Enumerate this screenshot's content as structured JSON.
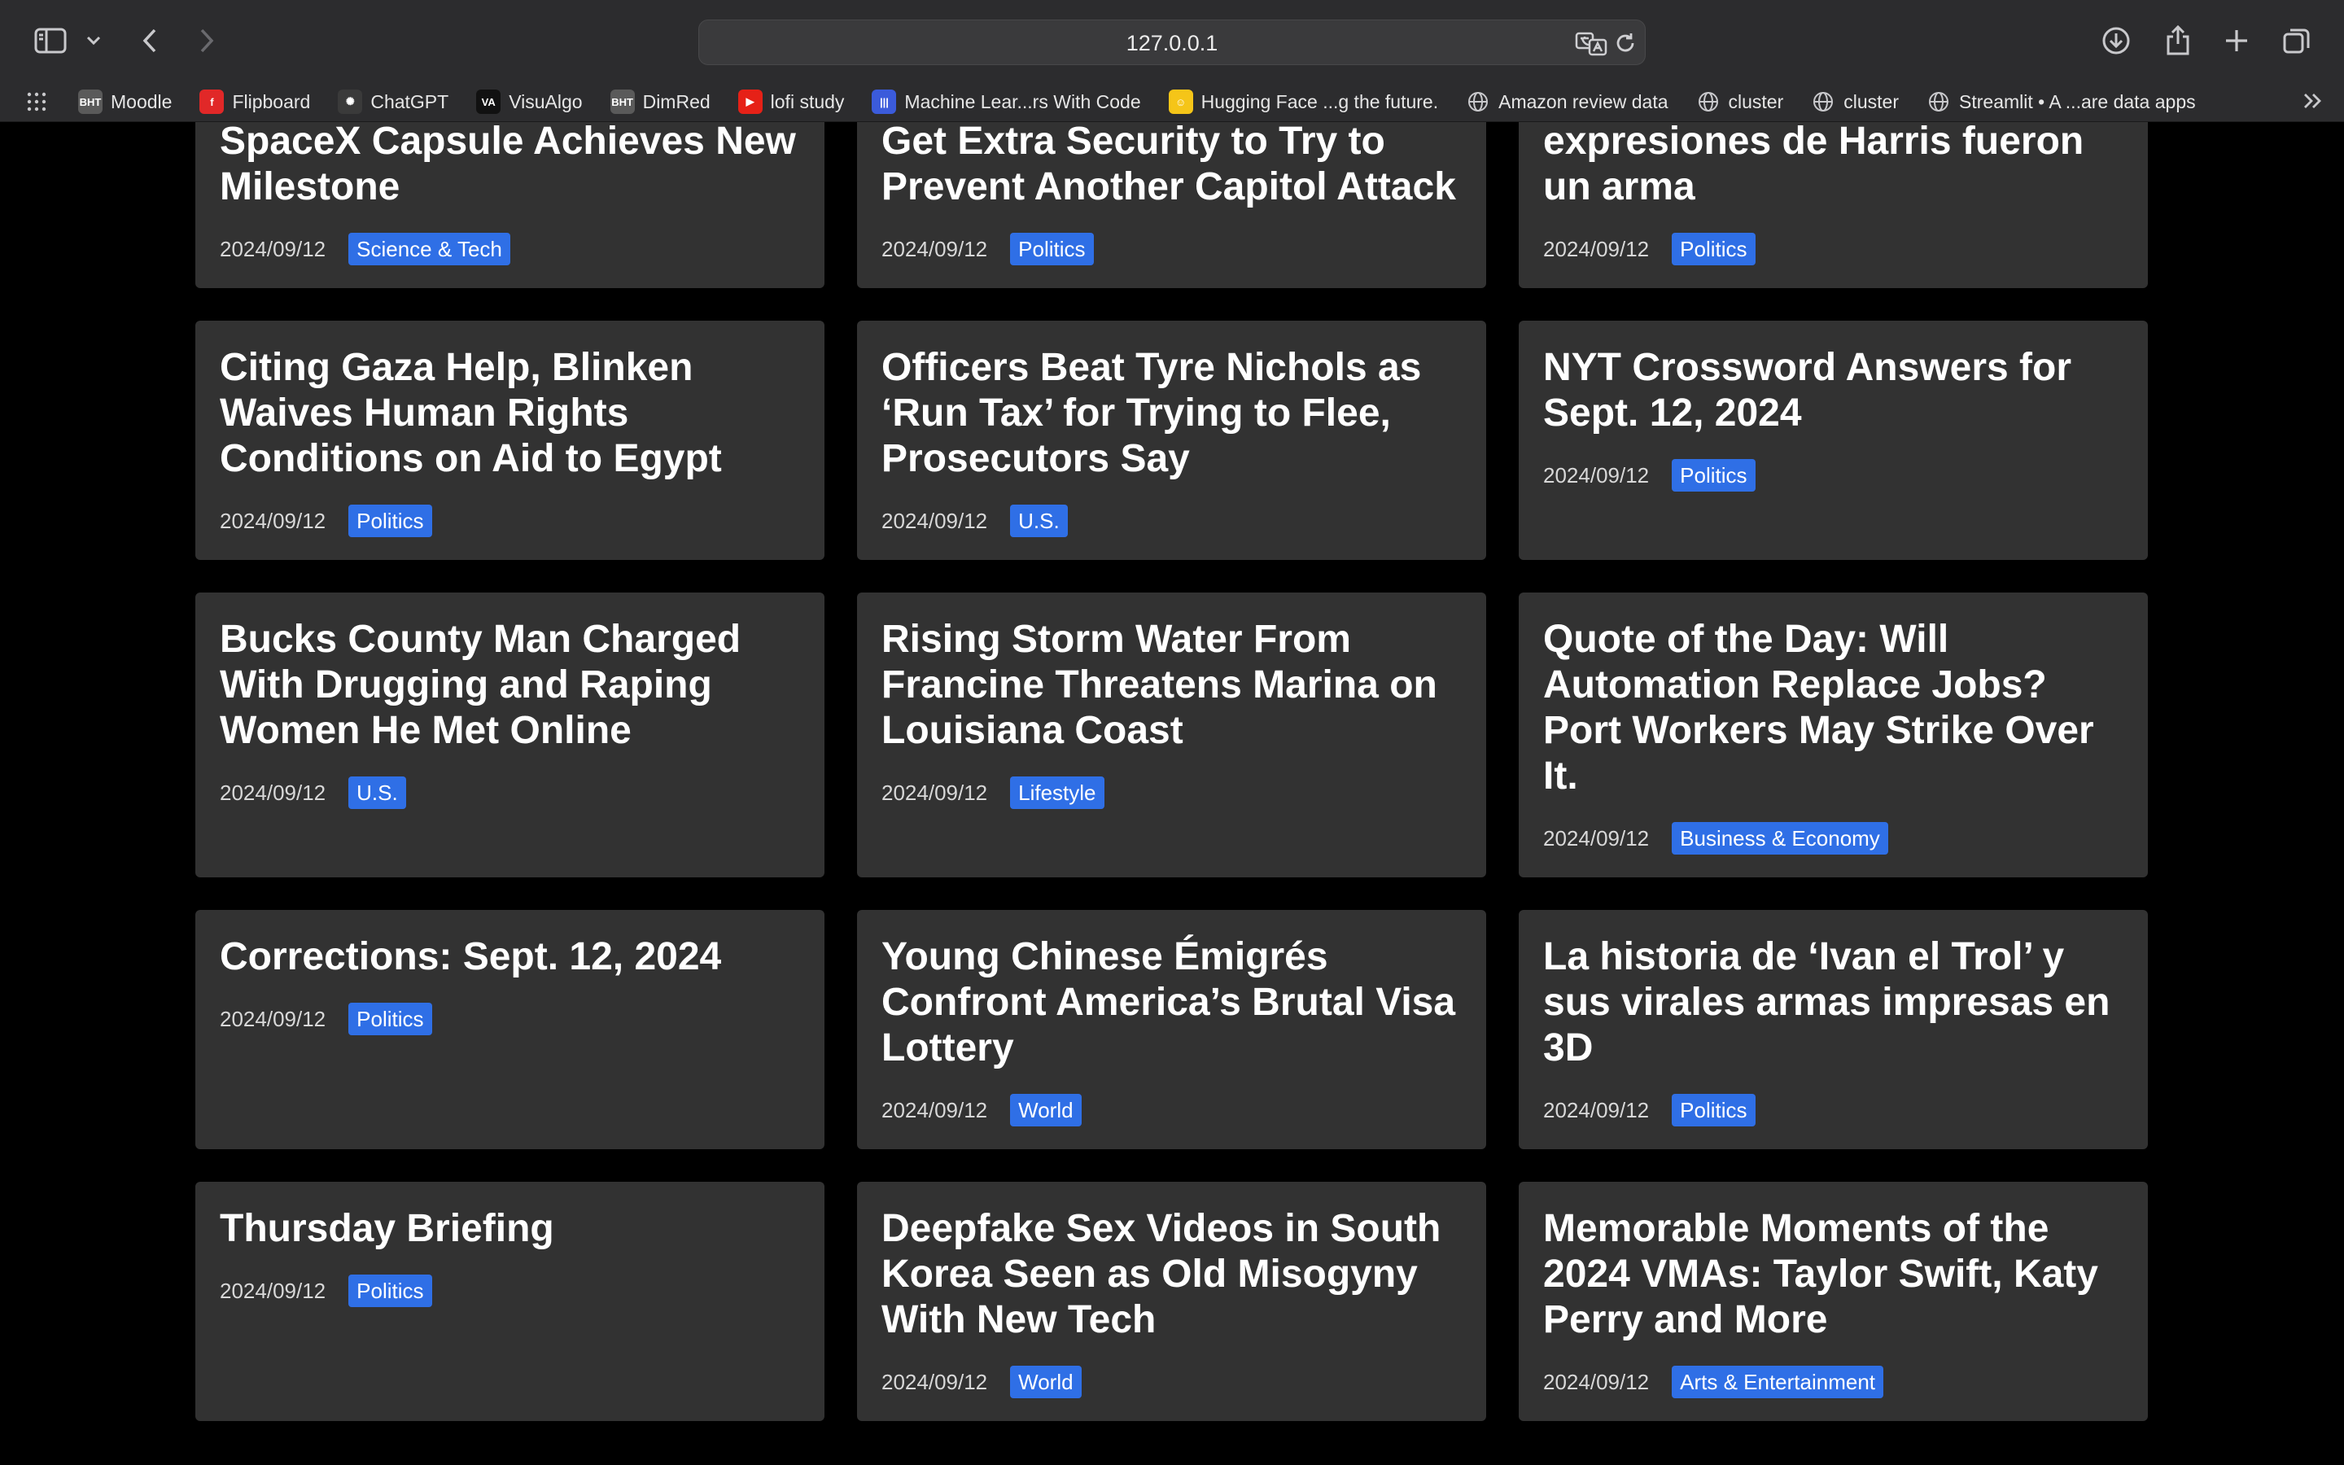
{
  "browser": {
    "url": "127.0.0.1",
    "bookmarks": [
      {
        "label": "Moodle",
        "icon": "bht-icon",
        "color": "#5a5a5a",
        "glyph": "BHT"
      },
      {
        "label": "Flipboard",
        "icon": "flipboard-icon",
        "color": "#e12828",
        "glyph": "f"
      },
      {
        "label": "ChatGPT",
        "icon": "chatgpt-icon",
        "color": "#3a3a3a",
        "glyph": "✺"
      },
      {
        "label": "VisuAlgo",
        "icon": "visualgo-icon",
        "color": "#111111",
        "glyph": "VA"
      },
      {
        "label": "DimRed",
        "icon": "bht-icon",
        "color": "#5a5a5a",
        "glyph": "BHT"
      },
      {
        "label": "lofi study",
        "icon": "youtube-icon",
        "color": "#e62117",
        "glyph": "▶"
      },
      {
        "label": "Machine Lear...rs With Code",
        "icon": "paperswithcode-icon",
        "color": "#3b5bdb",
        "glyph": "|||"
      },
      {
        "label": "Hugging Face ...g the future.",
        "icon": "huggingface-icon",
        "color": "#f5c518",
        "glyph": "☺"
      },
      {
        "label": "Amazon review data",
        "icon": "globe-icon",
        "color": "#2c2c2e",
        "glyph": "🌐"
      },
      {
        "label": "cluster",
        "icon": "globe-icon",
        "color": "#2c2c2e",
        "glyph": "🌐"
      },
      {
        "label": "cluster",
        "icon": "globe-icon",
        "color": "#2c2c2e",
        "glyph": "🌐"
      },
      {
        "label": "Streamlit • A ...are data apps",
        "icon": "globe-icon",
        "color": "#2c2c2e",
        "glyph": "🌐"
      }
    ]
  },
  "articles": [
    {
      "title": "First Private Spacewalk in SpaceX Capsule Achieves New Milestone",
      "date": "2024/09/12",
      "category": "Science & Tech"
    },
    {
      "title": "Certification of Election Will Get Extra Security to Try to Prevent Another Capitol Attack",
      "date": "2024/09/12",
      "category": "Politics"
    },
    {
      "title": "Al debatir con Trump, las expresiones de Harris fueron un arma",
      "date": "2024/09/12",
      "category": "Politics"
    },
    {
      "title": "Citing Gaza Help, Blinken Waives Human Rights Conditions on Aid to Egypt",
      "date": "2024/09/12",
      "category": "Politics"
    },
    {
      "title": "Officers Beat Tyre Nichols as ‘Run Tax’ for Trying to Flee, Prosecutors Say",
      "date": "2024/09/12",
      "category": "U.S."
    },
    {
      "title": "NYT Crossword Answers for Sept. 12, 2024",
      "date": "2024/09/12",
      "category": "Politics"
    },
    {
      "title": "Bucks County Man Charged With Drugging and Raping Women He Met Online",
      "date": "2024/09/12",
      "category": "U.S."
    },
    {
      "title": "Rising Storm Water From Francine Threatens Marina on Louisiana Coast",
      "date": "2024/09/12",
      "category": "Lifestyle"
    },
    {
      "title": "Quote of the Day: Will Automation Replace Jobs? Port Workers May Strike Over It.",
      "date": "2024/09/12",
      "category": "Business & Economy"
    },
    {
      "title": "Corrections: Sept. 12, 2024",
      "date": "2024/09/12",
      "category": "Politics"
    },
    {
      "title": "Young Chinese Émigrés Confront America’s Brutal Visa Lottery",
      "date": "2024/09/12",
      "category": "World"
    },
    {
      "title": "La historia de ‘Ivan el Trol’ y sus virales armas impresas en 3D",
      "date": "2024/09/12",
      "category": "Politics"
    },
    {
      "title": "Thursday Briefing",
      "date": "2024/09/12",
      "category": "Politics"
    },
    {
      "title": "Deepfake Sex Videos in South Korea Seen as Old Misogyny With New Tech",
      "date": "2024/09/12",
      "category": "World"
    },
    {
      "title": "Memorable Moments of the 2024 VMAs: Taylor Swift, Katy Perry and More",
      "date": "2024/09/12",
      "category": "Arts & Entertainment"
    }
  ],
  "colors": {
    "badge": "#2f6fe6",
    "card": "#323232",
    "background": "#000000"
  }
}
